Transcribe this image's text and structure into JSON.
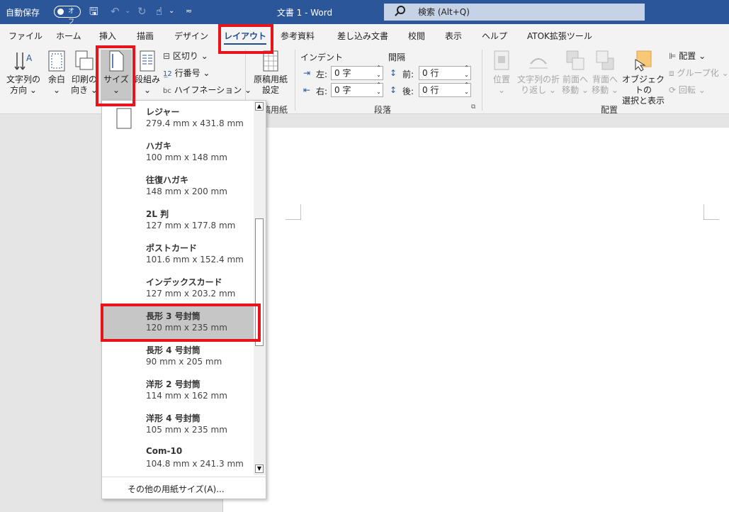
{
  "titlebar": {
    "autosave": "自動保存",
    "toggle": "オフ",
    "doc_title": "文書 1  -  Word",
    "search_placeholder": "検索 (Alt+Q)"
  },
  "tabs": [
    "ファイル",
    "ホーム",
    "挿入",
    "描画",
    "デザイン",
    "レイアウト",
    "参考資料",
    "差し込み文書",
    "校閲",
    "表示",
    "ヘルプ",
    "ATOK拡張ツール"
  ],
  "ribbon": {
    "text_direction": [
      "文字列の",
      "方向 ⌄"
    ],
    "margins": [
      "余白",
      "⌄"
    ],
    "orientation": [
      "印刷の",
      "向き ⌄"
    ],
    "size": [
      "サイズ",
      "⌄"
    ],
    "columns": [
      "段組み",
      "⌄"
    ],
    "breaks": "区切り ⌄",
    "line_numbers": "行番号 ⌄",
    "hyphenation": "ハイフネーション ⌄",
    "manuscript": [
      "原稿用紙",
      "設定"
    ],
    "manuscript_group": "稿用紙",
    "indent_label": "インデント",
    "spacing_label": "間隔",
    "indent_left_label": "左:",
    "indent_left_value": "0 字",
    "indent_right_label": "右:",
    "indent_right_value": "0 字",
    "spacing_before_label": "前:",
    "spacing_before_value": "0 行",
    "spacing_after_label": "後:",
    "spacing_after_value": "0 行",
    "paragraph_group": "段落",
    "position": [
      "位置",
      "⌄"
    ],
    "wrap_text": [
      "文字列の折",
      "り返し ⌄"
    ],
    "bring_forward": [
      "前面へ",
      "移動 ⌄"
    ],
    "send_backward": [
      "背面へ",
      "移動 ⌄"
    ],
    "selection_pane": [
      "オブジェクトの",
      "選択と表示"
    ],
    "align": "配置 ⌄",
    "group": "グループ化 ⌄",
    "rotate": "回転 ⌄",
    "arrange_group": "配置"
  },
  "size_menu": {
    "items": [
      {
        "name": "レジャー",
        "size": "279.4 mm x 431.8 mm"
      },
      {
        "name": "ハガキ",
        "size": "100 mm x 148 mm"
      },
      {
        "name": "往復ハガキ",
        "size": "148 mm x 200 mm"
      },
      {
        "name": "2L 判",
        "size": "127 mm x 177.8 mm"
      },
      {
        "name": "ポストカード",
        "size": "101.6 mm x 152.4 mm"
      },
      {
        "name": "インデックスカード",
        "size": "127 mm x 203.2 mm"
      },
      {
        "name": "長形 3 号封筒",
        "size": "120 mm x 235 mm"
      },
      {
        "name": "長形 4 号封筒",
        "size": "90 mm x 205 mm"
      },
      {
        "name": "洋形 2 号封筒",
        "size": "114 mm x 162 mm"
      },
      {
        "name": "洋形 4 号封筒",
        "size": "105 mm x 235 mm"
      },
      {
        "name": "Com-10",
        "size": "104.8 mm x 241.3 mm"
      }
    ],
    "more": "その他の用紙サイズ(A)..."
  },
  "colors": {
    "titlebar": "#2b579a",
    "highlight": "#e8141c",
    "accent": "#1e4e8c"
  }
}
